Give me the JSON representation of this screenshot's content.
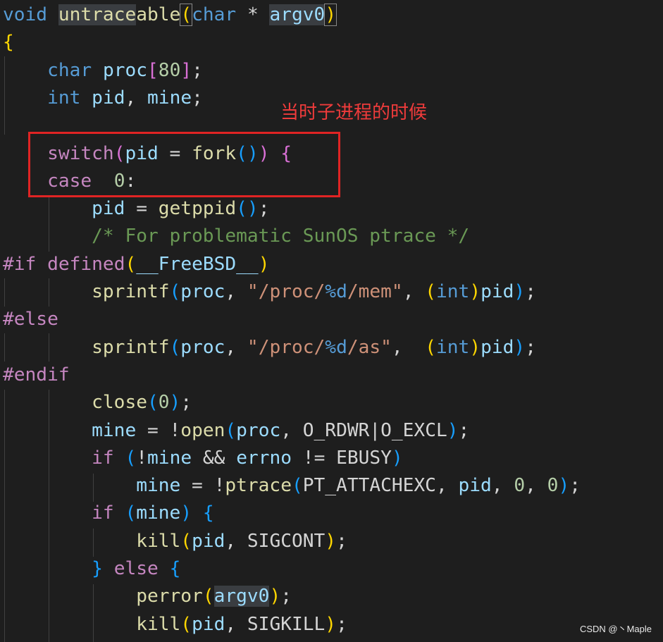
{
  "editor": {
    "lines": [
      [
        [
          "kw-blue",
          "void"
        ],
        [
          "ident",
          " "
        ],
        [
          "fn hl-fn",
          "untrace"
        ],
        [
          "fn",
          "able"
        ],
        [
          "br1 match-paren",
          "("
        ],
        [
          "kw-blue",
          "char"
        ],
        [
          "ident",
          " * "
        ],
        [
          "var hl-word",
          "argv0"
        ],
        [
          "br1 match-paren",
          ")"
        ]
      ],
      [
        [
          "br1",
          "{"
        ]
      ],
      [
        [
          "ident",
          "    "
        ],
        [
          "kw-blue",
          "char"
        ],
        [
          "ident",
          " "
        ],
        [
          "var",
          "proc"
        ],
        [
          "br2",
          "["
        ],
        [
          "num",
          "80"
        ],
        [
          "br2",
          "]"
        ],
        [
          "ident",
          ";"
        ]
      ],
      [
        [
          "ident",
          "    "
        ],
        [
          "kw-blue",
          "int"
        ],
        [
          "ident",
          " "
        ],
        [
          "var",
          "pid"
        ],
        [
          "ident",
          ", "
        ],
        [
          "var",
          "mine"
        ],
        [
          "ident",
          ";"
        ]
      ],
      [],
      [
        [
          "ident",
          "    "
        ],
        [
          "kw-purple",
          "switch"
        ],
        [
          "br2",
          "("
        ],
        [
          "var",
          "pid"
        ],
        [
          "ident",
          " = "
        ],
        [
          "fn",
          "fork"
        ],
        [
          "br3",
          "()"
        ],
        [
          "br2",
          ")"
        ],
        [
          "ident",
          " "
        ],
        [
          "br2",
          "{"
        ]
      ],
      [
        [
          "ident",
          "    "
        ],
        [
          "kw-purple",
          "case"
        ],
        [
          "ident",
          "  "
        ],
        [
          "num",
          "0"
        ],
        [
          "ident",
          ":"
        ]
      ],
      [
        [
          "ident",
          "        "
        ],
        [
          "var",
          "pid"
        ],
        [
          "ident",
          " = "
        ],
        [
          "fn",
          "getppid"
        ],
        [
          "br3",
          "()"
        ],
        [
          "ident",
          ";"
        ]
      ],
      [
        [
          "ident",
          "        "
        ],
        [
          "com",
          "/* For problematic SunOS ptrace */"
        ]
      ],
      [
        [
          "kw-purple",
          "#if"
        ],
        [
          "ident",
          " "
        ],
        [
          "kw-purple",
          "defined"
        ],
        [
          "br1",
          "("
        ],
        [
          "var",
          "__FreeBSD__"
        ],
        [
          "br1",
          ")"
        ]
      ],
      [
        [
          "ident",
          "        "
        ],
        [
          "fn",
          "sprintf"
        ],
        [
          "br3",
          "("
        ],
        [
          "var",
          "proc"
        ],
        [
          "ident",
          ", "
        ],
        [
          "str",
          "\"/proc/"
        ],
        [
          "kw-blue",
          "%d"
        ],
        [
          "str",
          "/mem\""
        ],
        [
          "ident",
          ", "
        ],
        [
          "br1",
          "("
        ],
        [
          "kw-blue",
          "int"
        ],
        [
          "br1",
          ")"
        ],
        [
          "var",
          "pid"
        ],
        [
          "br3",
          ")"
        ],
        [
          "ident",
          ";"
        ]
      ],
      [
        [
          "kw-purple",
          "#else"
        ]
      ],
      [
        [
          "ident",
          "        "
        ],
        [
          "fn",
          "sprintf"
        ],
        [
          "br3",
          "("
        ],
        [
          "var",
          "proc"
        ],
        [
          "ident",
          ", "
        ],
        [
          "str",
          "\"/proc/"
        ],
        [
          "kw-blue",
          "%d"
        ],
        [
          "str",
          "/as\""
        ],
        [
          "ident",
          ",  "
        ],
        [
          "br1",
          "("
        ],
        [
          "kw-blue",
          "int"
        ],
        [
          "br1",
          ")"
        ],
        [
          "var",
          "pid"
        ],
        [
          "br3",
          ")"
        ],
        [
          "ident",
          ";"
        ]
      ],
      [
        [
          "kw-purple",
          "#endif"
        ]
      ],
      [
        [
          "ident",
          "        "
        ],
        [
          "fn",
          "close"
        ],
        [
          "br3",
          "("
        ],
        [
          "num",
          "0"
        ],
        [
          "br3",
          ")"
        ],
        [
          "ident",
          ";"
        ]
      ],
      [
        [
          "ident",
          "        "
        ],
        [
          "var",
          "mine"
        ],
        [
          "ident",
          " = !"
        ],
        [
          "fn",
          "open"
        ],
        [
          "br3",
          "("
        ],
        [
          "var",
          "proc"
        ],
        [
          "ident",
          ", O_RDWR|O_EXCL"
        ],
        [
          "br3",
          ")"
        ],
        [
          "ident",
          ";"
        ]
      ],
      [
        [
          "ident",
          "        "
        ],
        [
          "kw-purple",
          "if"
        ],
        [
          "ident",
          " "
        ],
        [
          "br3",
          "("
        ],
        [
          "ident",
          "!"
        ],
        [
          "var",
          "mine"
        ],
        [
          "ident",
          " && "
        ],
        [
          "var",
          "errno"
        ],
        [
          "ident",
          " != EBUSY"
        ],
        [
          "br3",
          ")"
        ]
      ],
      [
        [
          "ident",
          "            "
        ],
        [
          "var",
          "mine"
        ],
        [
          "ident",
          " = !"
        ],
        [
          "fn",
          "ptrace"
        ],
        [
          "br3",
          "("
        ],
        [
          "ident",
          "PT_ATTACHEXC, "
        ],
        [
          "var",
          "pid"
        ],
        [
          "ident",
          ", "
        ],
        [
          "num",
          "0"
        ],
        [
          "ident",
          ", "
        ],
        [
          "num",
          "0"
        ],
        [
          "br3",
          ")"
        ],
        [
          "ident",
          ";"
        ]
      ],
      [
        [
          "ident",
          "        "
        ],
        [
          "kw-purple",
          "if"
        ],
        [
          "ident",
          " "
        ],
        [
          "br3",
          "("
        ],
        [
          "var",
          "mine"
        ],
        [
          "br3",
          ")"
        ],
        [
          "ident",
          " "
        ],
        [
          "br3",
          "{"
        ]
      ],
      [
        [
          "ident",
          "            "
        ],
        [
          "fn",
          "kill"
        ],
        [
          "br1",
          "("
        ],
        [
          "var",
          "pid"
        ],
        [
          "ident",
          ", SIGCONT"
        ],
        [
          "br1",
          ")"
        ],
        [
          "ident",
          ";"
        ]
      ],
      [
        [
          "ident",
          "        "
        ],
        [
          "br3",
          "}"
        ],
        [
          "ident",
          " "
        ],
        [
          "kw-purple",
          "else"
        ],
        [
          "ident",
          " "
        ],
        [
          "br3",
          "{"
        ]
      ],
      [
        [
          "ident",
          "            "
        ],
        [
          "fn",
          "perror"
        ],
        [
          "br1",
          "("
        ],
        [
          "var hl-word",
          "argv0"
        ],
        [
          "br1",
          ")"
        ],
        [
          "ident",
          ";"
        ]
      ],
      [
        [
          "ident",
          "            "
        ],
        [
          "fn",
          "kill"
        ],
        [
          "br1",
          "("
        ],
        [
          "var",
          "pid"
        ],
        [
          "ident",
          ", SIGKILL"
        ],
        [
          "br1",
          ")"
        ],
        [
          "ident",
          ";"
        ]
      ]
    ]
  },
  "annotation": {
    "text": "当时子进程的时候"
  },
  "watermark": {
    "text": "CSDN @丶Maple"
  }
}
